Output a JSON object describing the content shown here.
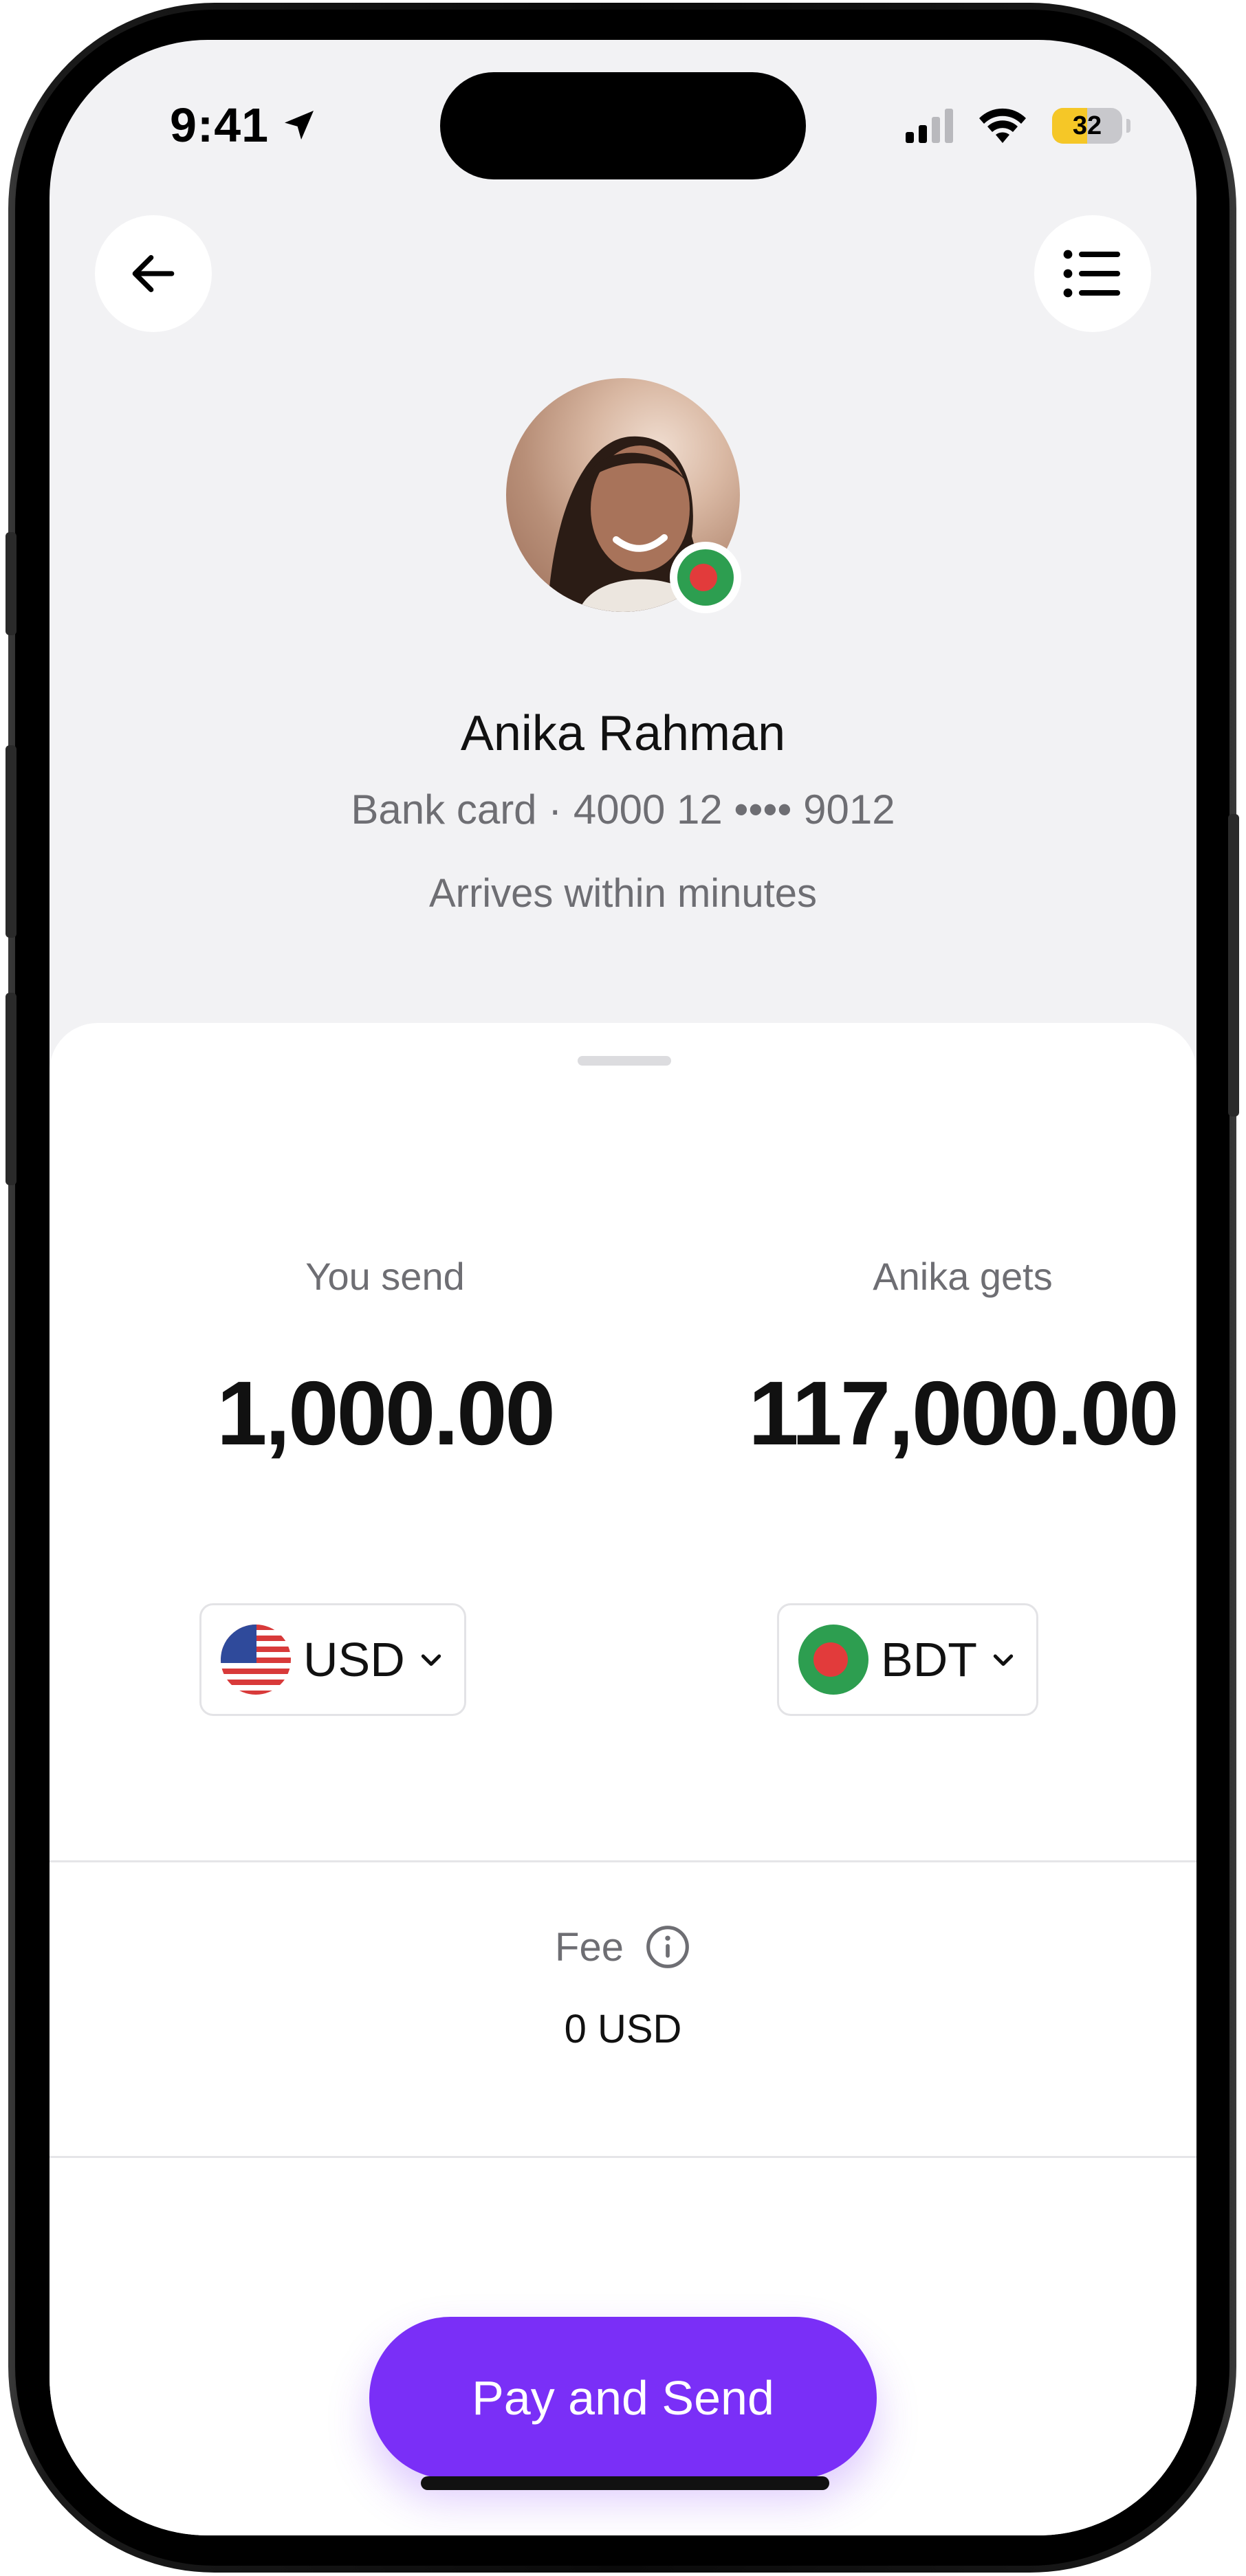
{
  "status_bar": {
    "time": "9:41",
    "battery": "32",
    "location_icon": "location-arrow-icon",
    "wifi_icon": "wifi-icon",
    "signal_icon": "cellular-signal-icon"
  },
  "header": {
    "back_icon": "arrow-left-icon",
    "menu_icon": "list-icon"
  },
  "recipient": {
    "name": "Anika Rahman",
    "card_line": "Bank card · 4000 12 •••• 9012",
    "arrival": "Arrives within minutes",
    "flag_icon": "bangladesh-flag-icon"
  },
  "transfer": {
    "send": {
      "label": "You send",
      "amount": "1,000.00",
      "currency": "USD",
      "flag_icon": "us-flag-icon"
    },
    "receive": {
      "label": "Anika gets",
      "amount": "117,000.00",
      "currency": "BDT",
      "flag_icon": "bangladesh-flag-icon"
    }
  },
  "fee": {
    "label": "Fee",
    "value": "0 USD",
    "info_icon": "info-icon"
  },
  "actions": {
    "pay_label": "Pay and Send"
  },
  "colors": {
    "accent": "#7a2ff7",
    "background": "#f2f2f4",
    "sheet": "#ffffff",
    "bd_green": "#2d9e50",
    "bd_red": "#e23b3b"
  }
}
